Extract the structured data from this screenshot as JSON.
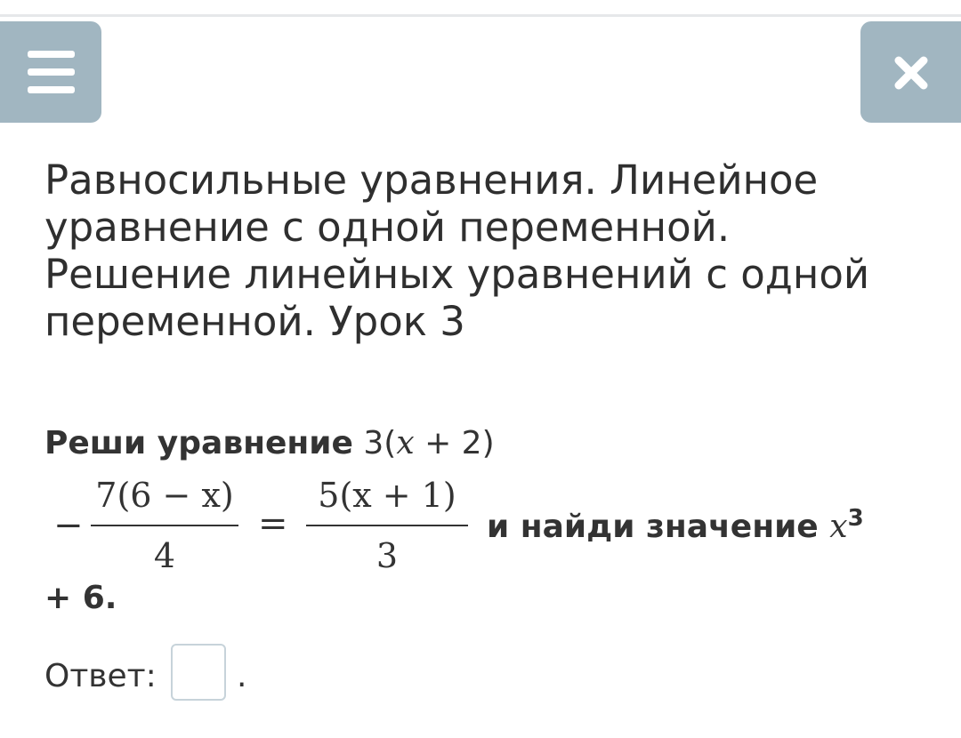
{
  "header": {
    "menu_icon": "menu-icon",
    "close_icon": "close-icon",
    "button_color": "#a1b6c1"
  },
  "lesson": {
    "title": "Равносильные уравнения. Линейное уравнение с одной переменной. Решение линейных уравнений с одной переменной. Урок 3"
  },
  "task": {
    "instruction": "Реши уравнение",
    "equation_prefix_coef": "3(",
    "equation_var": "x",
    "equation_prefix_rest": " + 2)",
    "minus_sign": "−",
    "fraction1_numerator": "7(6 − x)",
    "fraction1_denominator": "4",
    "equals_sign": "=",
    "fraction2_numerator": "5(x + 1)",
    "fraction2_denominator": "3",
    "find_text": "и найди значение",
    "find_var": "x",
    "find_power": "3",
    "find_suffix": "+ 6."
  },
  "answer": {
    "label": "Ответ:",
    "value": "",
    "suffix": "."
  }
}
